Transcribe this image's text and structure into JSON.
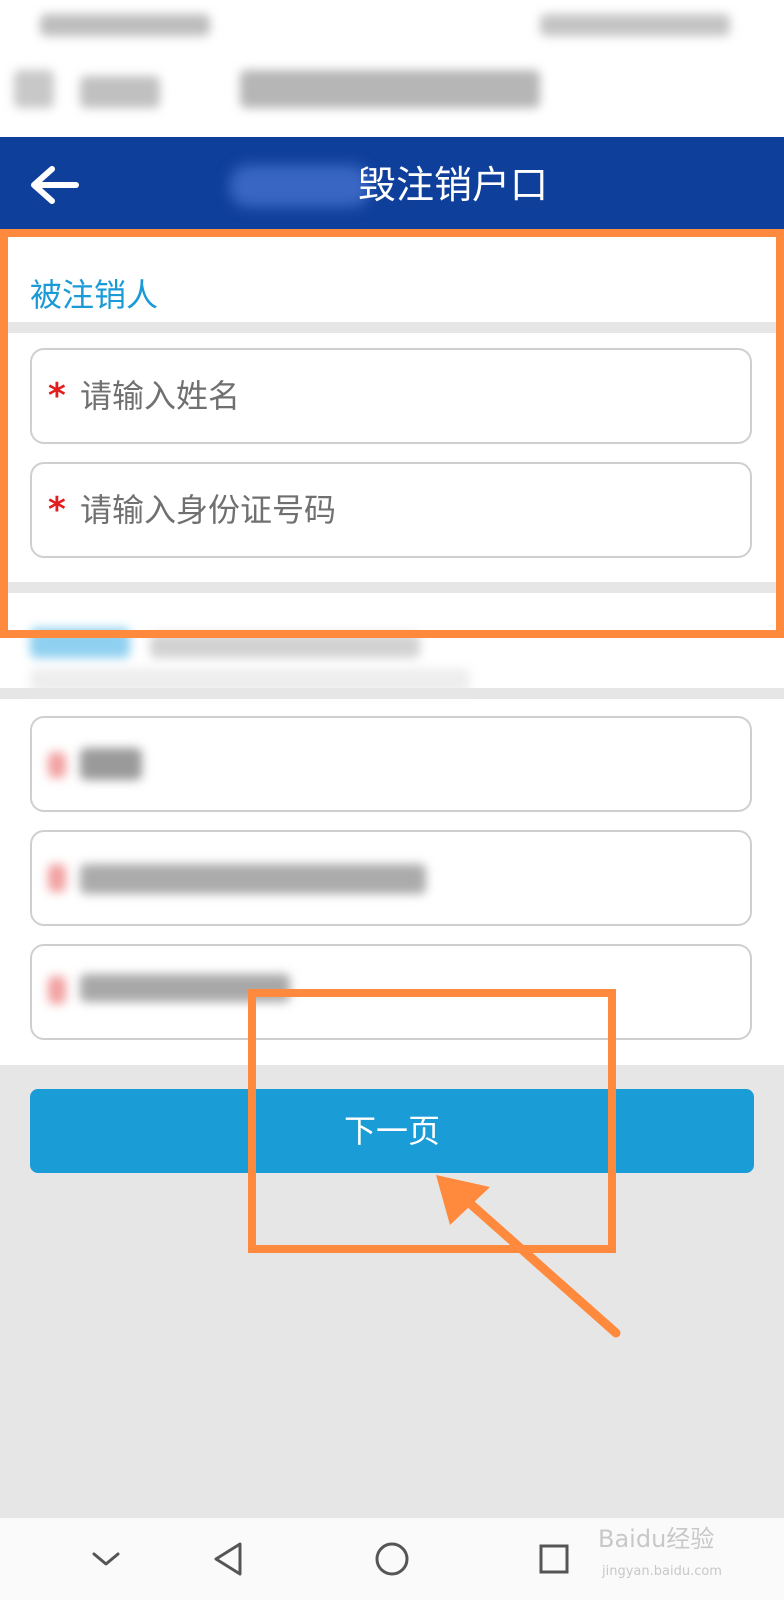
{
  "header": {
    "title": "毁注销户口"
  },
  "section": {
    "title": "被注销人"
  },
  "form": {
    "name_placeholder": "请输入姓名",
    "id_placeholder": "请输入身份证号码",
    "required_mark": "*"
  },
  "button": {
    "next_label": "下一页"
  },
  "watermark": {
    "main": "Baidu经验",
    "sub": "jingyan.baidu.com"
  },
  "colors": {
    "header": "#0e3f9b",
    "accent": "#1a9cd6",
    "highlight": "#ff8a3d",
    "required": "#e11d1d"
  },
  "icons": {
    "back": "back-arrow-icon",
    "nav_down": "chevron-down-icon",
    "nav_back": "triangle-back-icon",
    "nav_home": "circle-home-icon",
    "nav_recent": "square-recent-icon"
  }
}
